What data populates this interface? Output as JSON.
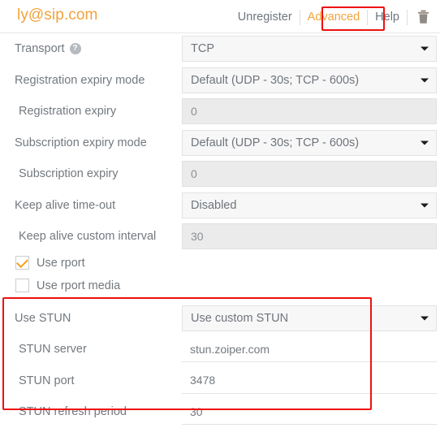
{
  "header": {
    "title": "ly@sip.com",
    "actions": [
      {
        "label": "Unregister",
        "accent": false
      },
      {
        "label": "Advanced",
        "accent": true
      },
      {
        "label": "Help",
        "accent": false
      }
    ],
    "delete_icon": "trash-icon",
    "accent_color": "#f2a33c",
    "annotation_color": "#ee1111"
  },
  "form": {
    "rows": [
      {
        "label": "Transport",
        "help": "?",
        "type": "select",
        "value": "TCP"
      },
      {
        "label": "Registration expiry mode",
        "type": "select",
        "value": "Default (UDP - 30s; TCP - 600s)"
      },
      {
        "label": "Registration expiry",
        "type": "input-disabled",
        "value": "0",
        "indent": true
      },
      {
        "label": "Subscription expiry mode",
        "type": "select",
        "value": "Default (UDP - 30s; TCP - 600s)"
      },
      {
        "label": "Subscription expiry",
        "type": "input-disabled",
        "value": "0",
        "indent": true
      },
      {
        "label": "Keep alive time-out",
        "type": "select",
        "value": "Disabled"
      },
      {
        "label": "Keep alive custom interval",
        "type": "input-disabled",
        "value": "30",
        "indent": true
      }
    ],
    "checkboxes": [
      {
        "label": "Use rport",
        "checked": true
      },
      {
        "label": "Use rport media",
        "checked": false
      }
    ],
    "stun_rows": [
      {
        "label": "Use STUN",
        "type": "select",
        "value": "Use custom STUN"
      },
      {
        "label": "STUN server",
        "type": "input-underline",
        "value": "stun.zoiper.com",
        "indent": true
      },
      {
        "label": "STUN port",
        "type": "input-underline",
        "value": "3478",
        "indent": true
      },
      {
        "label": "STUN refresh period",
        "type": "input-underline",
        "value": "30",
        "indent": true
      }
    ]
  }
}
